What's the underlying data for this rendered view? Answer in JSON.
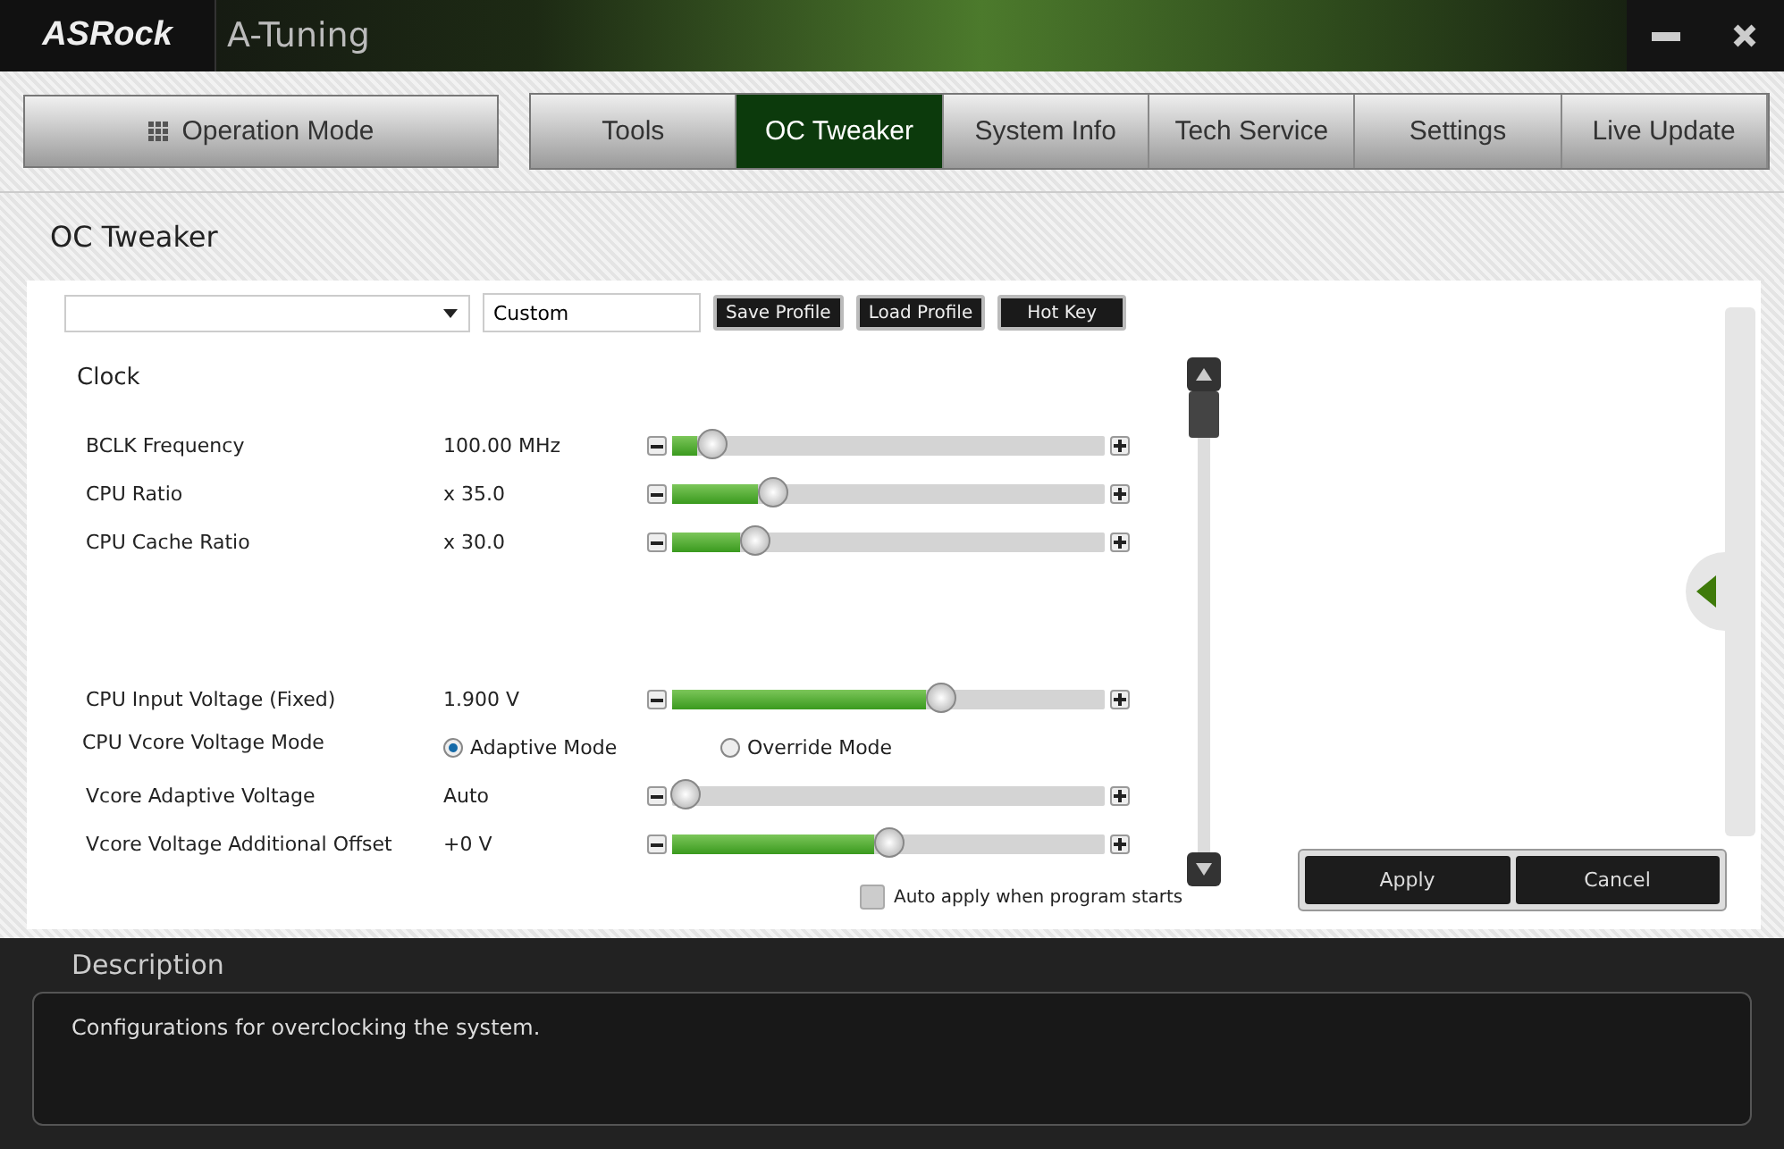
{
  "window": {
    "logo": "ASRock",
    "title": "A-Tuning"
  },
  "mode_button": {
    "label": "Operation Mode"
  },
  "tabs": [
    {
      "label": "Tools",
      "selected": false
    },
    {
      "label": "OC Tweaker",
      "selected": true
    },
    {
      "label": "System Info",
      "selected": false
    },
    {
      "label": "Tech Service",
      "selected": false
    },
    {
      "label": "Settings",
      "selected": false
    },
    {
      "label": "Live Update",
      "selected": false
    }
  ],
  "page_title": "OC Tweaker",
  "toolbar": {
    "profile_name": "Custom",
    "buttons": [
      "Save Profile",
      "Load Profile",
      "Hot Key"
    ]
  },
  "sections": [
    {
      "title": "Clock",
      "rows": [
        {
          "kind": "slider",
          "label": "BCLK Frequency",
          "reading": "100.00 MHz",
          "level": 0.09
        },
        {
          "kind": "slider",
          "label": "CPU Ratio",
          "reading": "x 35.0",
          "level": 0.23
        },
        {
          "kind": "slider",
          "label": "CPU Cache Ratio",
          "reading": "x 30.0",
          "level": 0.19
        }
      ]
    },
    {
      "rows": [
        {
          "kind": "slider",
          "label": "CPU Input Voltage (Fixed)",
          "reading": "1.900 V",
          "level": 0.62
        },
        {
          "kind": "radio",
          "label": "CPU Vcore Voltage Mode",
          "options": [
            {
              "label": "Adaptive Mode",
              "selected": true
            },
            {
              "label": "Override Mode",
              "selected": false
            }
          ]
        },
        {
          "kind": "slider",
          "label": "Vcore Adaptive Voltage",
          "reading": "Auto",
          "level": 0.03
        },
        {
          "kind": "slider",
          "label": "Vcore Voltage Additional Offset",
          "reading": "+0 V",
          "level": 0.5
        }
      ]
    }
  ],
  "auto_apply": {
    "label": "Auto apply when program starts",
    "checked": false
  },
  "actions": [
    "Apply",
    "Cancel"
  ],
  "description": {
    "title": "Description",
    "text": "Configurations for overclocking the system."
  }
}
